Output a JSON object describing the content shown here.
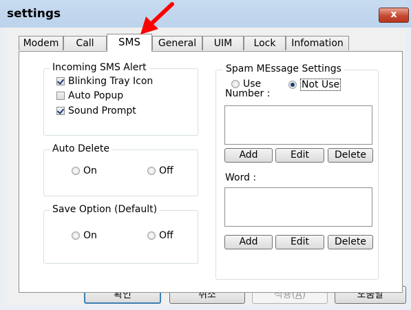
{
  "window": {
    "title": "settings",
    "close_glyph": "x"
  },
  "tabs": [
    {
      "label": "Modem"
    },
    {
      "label": "Call"
    },
    {
      "label": "SMS",
      "active": true
    },
    {
      "label": "General"
    },
    {
      "label": "UIM"
    },
    {
      "label": "Lock"
    },
    {
      "label": "Infomation"
    }
  ],
  "incoming": {
    "title": "Incoming SMS Alert",
    "options": [
      {
        "label": "Blinking Tray Icon",
        "checked": true
      },
      {
        "label": "Auto Popup",
        "checked": false
      },
      {
        "label": "Sound Prompt",
        "checked": true
      }
    ]
  },
  "auto_delete": {
    "title": "Auto Delete",
    "on": "On",
    "off": "Off"
  },
  "save_option": {
    "title": "Save Option (Default)",
    "on": "On",
    "off": "Off"
  },
  "spam": {
    "title": "Spam MEssage Settings",
    "use": "Use",
    "not_use": "Not Use",
    "selected": "not_use",
    "number_label": "Number :",
    "word_label": "Word :",
    "add": "Add",
    "edit": "Edit",
    "delete": "Delete"
  },
  "footer": {
    "ok": "확인",
    "cancel": "취소",
    "apply_prefix": "적용(",
    "apply_mnemonic": "A",
    "apply_suffix": ")",
    "help": "도움말"
  },
  "colors": {
    "annotation_arrow": "#ff0000",
    "checkmark": "#1c3a7a"
  },
  "icons": {
    "close": "close-icon",
    "annotation": "red-arrow-icon"
  }
}
